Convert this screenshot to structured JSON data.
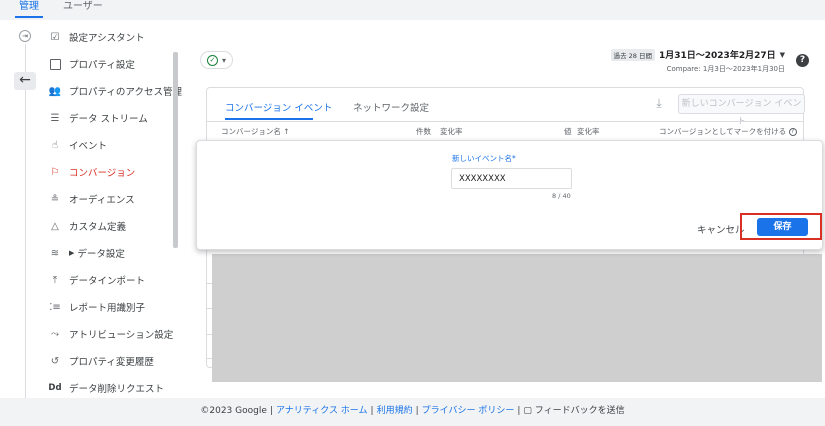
{
  "tabs": [
    {
      "label": "管理",
      "active": true
    },
    {
      "label": "ユーザー",
      "active": false
    }
  ],
  "sidebar": {
    "collapse_icon": "collapse-icon",
    "back_icon": "arrow-left-icon",
    "items": [
      {
        "label": "設定アシスタント",
        "icon": "checkbox-icon"
      },
      {
        "label": "プロパティ設定",
        "icon": "property-icon"
      },
      {
        "label": "プロパティのアクセス管理",
        "icon": "people-icon"
      },
      {
        "label": "データ ストリーム",
        "icon": "streams-icon"
      },
      {
        "label": "イベント",
        "icon": "touch-icon"
      },
      {
        "label": "コンバージョン",
        "icon": "flag-icon",
        "active": true
      },
      {
        "label": "オーディエンス",
        "icon": "audience-icon"
      },
      {
        "label": "カスタム定義",
        "icon": "shapes-icon"
      },
      {
        "label": "データ設定",
        "icon": "database-icon",
        "expandable": true
      },
      {
        "label": "データインポート",
        "icon": "upload-icon"
      },
      {
        "label": "レポート用識別子",
        "icon": "identifier-icon"
      },
      {
        "label": "アトリビューション設定",
        "icon": "attribution-icon"
      },
      {
        "label": "プロパティ変更履歴",
        "icon": "history-icon"
      },
      {
        "label": "データ削除リクエスト",
        "icon": "dd-icon",
        "icon_text": "Dd"
      }
    ]
  },
  "header": {
    "status_icon": "check-circle-icon",
    "period_badge": "過去 28 日間",
    "date_range": "1月31日～2023年2月27日",
    "compare": "Compare: 1月3日～2023年1月30日",
    "help_label": "?"
  },
  "card": {
    "tabs": [
      {
        "label": "コンバージョン イベント",
        "active": true
      },
      {
        "label": "ネットワーク設定",
        "active": false
      }
    ],
    "download_icon": "download-icon",
    "new_button_label": "新しいコンバージョン イベント",
    "columns": [
      {
        "label": "コンバージョン名 ↑"
      },
      {
        "label": "件数"
      },
      {
        "label": "変化率"
      },
      {
        "label": "値"
      },
      {
        "label": "変化率"
      },
      {
        "label": "コンバージョンとしてマークを付ける"
      }
    ]
  },
  "dialog": {
    "field_label": "新しいイベント名*",
    "field_value": "XXXXXXXX",
    "char_count": "8 / 40",
    "cancel_label": "キャンセル",
    "save_label": "保存",
    "highlight_color": "#d93025"
  },
  "footer": {
    "copyright": "©2023 Google",
    "links": [
      "アナリティクス ホーム",
      "利用規約",
      "プライバシー ポリシー"
    ],
    "feedback_label": "フィードバックを送信"
  },
  "colors": {
    "accent": "#1a73e8",
    "active_nav": "#d93025",
    "success": "#188038"
  }
}
